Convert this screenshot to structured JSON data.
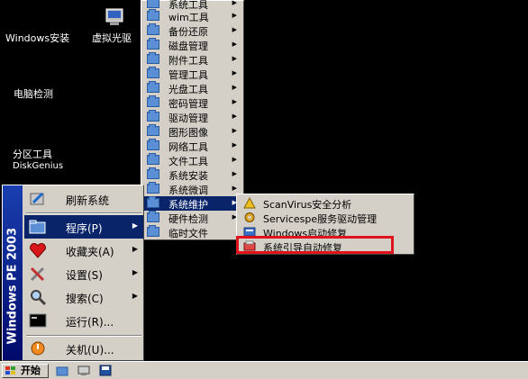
{
  "desktop": {
    "icons": [
      {
        "label": "Windows安装"
      },
      {
        "label": "虚拟光驱"
      },
      {
        "label": "电脑检测"
      },
      {
        "label": "分区工具"
      },
      {
        "label": "DiskGenius"
      }
    ]
  },
  "start_menu": {
    "sidebar_text": "Windows PE 2003",
    "items": [
      {
        "label": "刷新系统",
        "icon": "refresh-icon"
      },
      {
        "label": "程序(P)",
        "icon": "programs-icon"
      },
      {
        "label": "收藏夹(A)",
        "icon": "favorites-heart-icon"
      },
      {
        "label": "设置(S)",
        "icon": "settings-tools-icon"
      },
      {
        "label": "搜索(C)",
        "icon": "search-magnifier-icon"
      },
      {
        "label": "运行(R)...",
        "icon": "run-icon"
      },
      {
        "label": "关机(U)...",
        "icon": "shutdown-icon"
      }
    ]
  },
  "programs_menu": {
    "items": [
      {
        "label": "系统工具"
      },
      {
        "label": "wim工具"
      },
      {
        "label": "备份还原"
      },
      {
        "label": "磁盘管理"
      },
      {
        "label": "附件工具"
      },
      {
        "label": "管理工具"
      },
      {
        "label": "光盘工具"
      },
      {
        "label": "密码管理"
      },
      {
        "label": "驱动管理"
      },
      {
        "label": "图形图像"
      },
      {
        "label": "网络工具"
      },
      {
        "label": "文件工具"
      },
      {
        "label": "系统安装"
      },
      {
        "label": "系统微调"
      },
      {
        "label": "系统维护"
      },
      {
        "label": "硬件检测"
      },
      {
        "label": "临时文件"
      }
    ]
  },
  "system_maintenance_menu": {
    "items": [
      {
        "label": "ScanVirus安全分析"
      },
      {
        "label": "Servicespe服务驱动管理"
      },
      {
        "label": "Windows启动修复"
      },
      {
        "label": "系统引导自动修复"
      }
    ]
  },
  "taskbar": {
    "start_label": "开始"
  },
  "colors": {
    "desktop_bg": "#000000",
    "menu_bg": "#d4d0c8",
    "selection": "#0a246a",
    "highlight_box": "#e0121b"
  }
}
